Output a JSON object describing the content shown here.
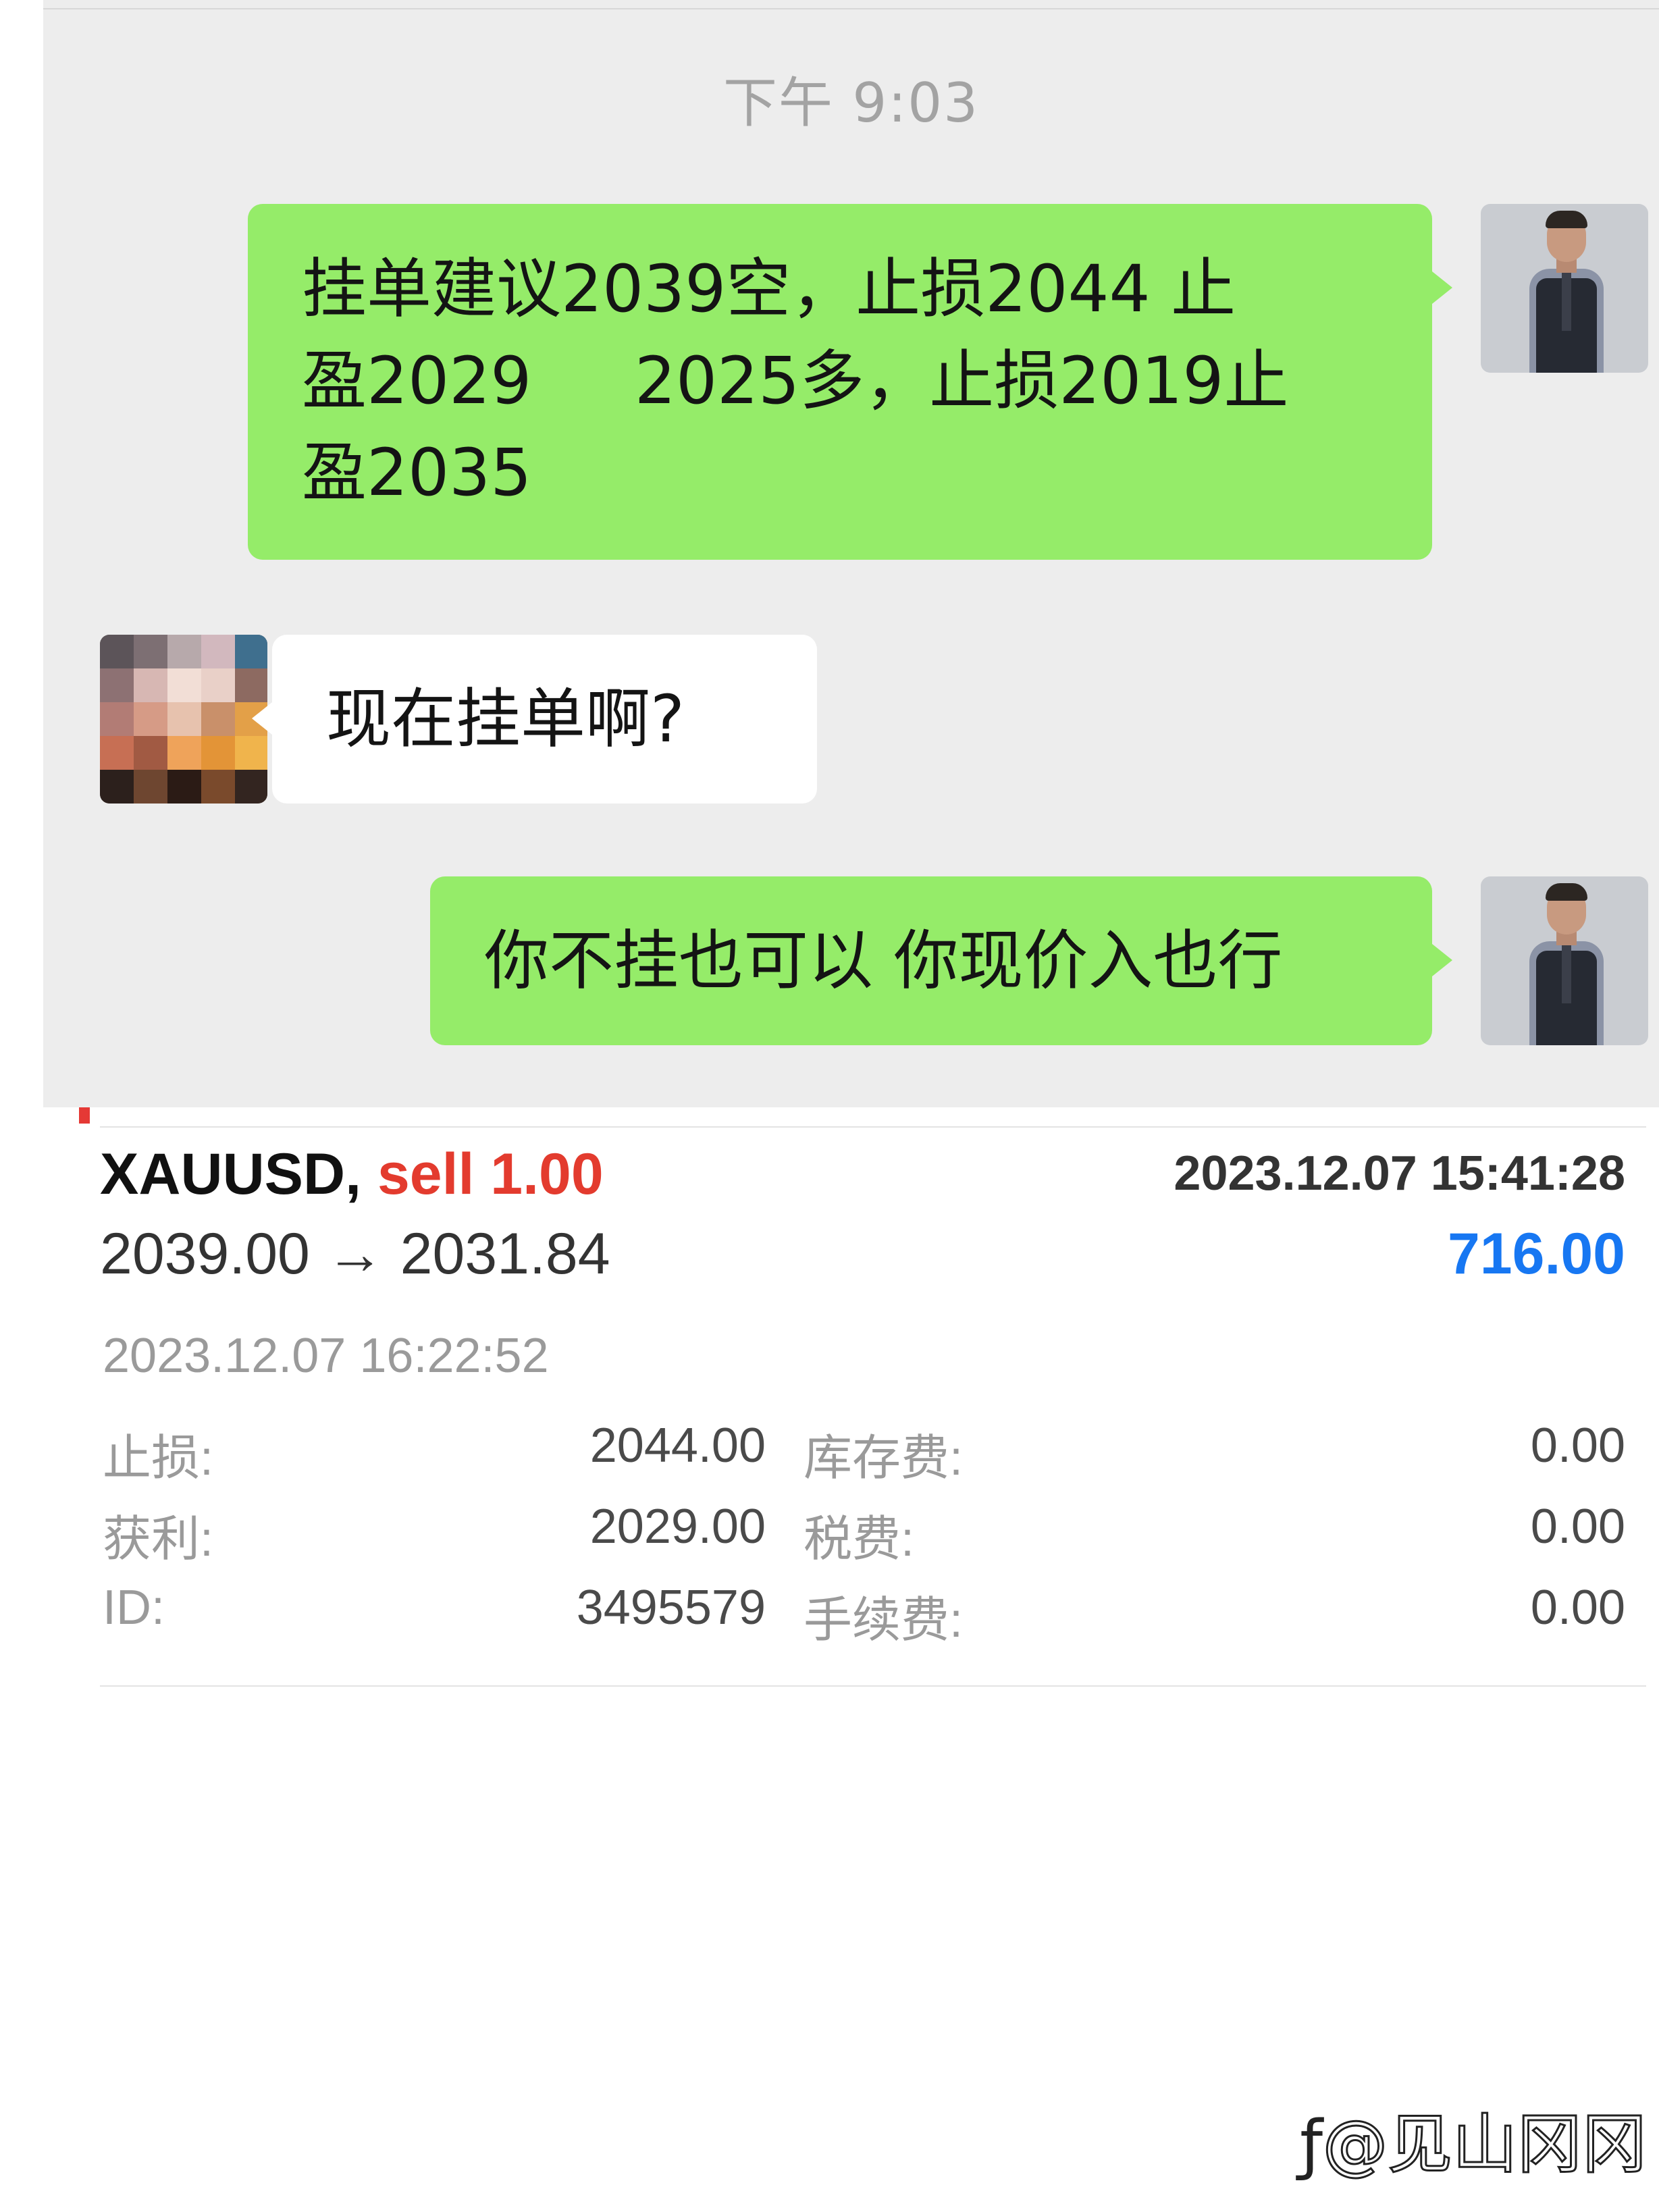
{
  "chat": {
    "time": "下午 9:03",
    "messages": [
      {
        "sender": "me",
        "lines": [
          "挂单建议2039空，止损2044 止",
          "盈2029     2025多，止损2019止",
          "盈2035"
        ]
      },
      {
        "sender": "them",
        "text": "现在挂单啊?"
      },
      {
        "sender": "me",
        "text": "你不挂也可以 你现价入也行"
      }
    ]
  },
  "trade": {
    "symbol": "XAUUSD,",
    "side_volume": "sell 1.00",
    "open_time": "2023.12.07 15:41:28",
    "prices": "2039.00 → 2031.84",
    "profit": "716.00",
    "close_time": "2023.12.07 16:22:52",
    "details": {
      "sl_label": "止损:",
      "sl_value": "2044.00",
      "tp_label": "获利:",
      "tp_value": "2029.00",
      "id_label": "ID:",
      "id_value": "3495579",
      "swap_label": "库存费:",
      "swap_value": "0.00",
      "tax_label": "税费:",
      "tax_value": "0.00",
      "commission_label": "手续费:",
      "commission_value": "0.00"
    },
    "colors": {
      "sell": "#e33b2e",
      "profit": "#1777f2"
    }
  },
  "watermark": {
    "text": "@见山冈冈"
  },
  "icons": {
    "chat_bubble_me": "green",
    "chat_bubble_them": "white"
  }
}
